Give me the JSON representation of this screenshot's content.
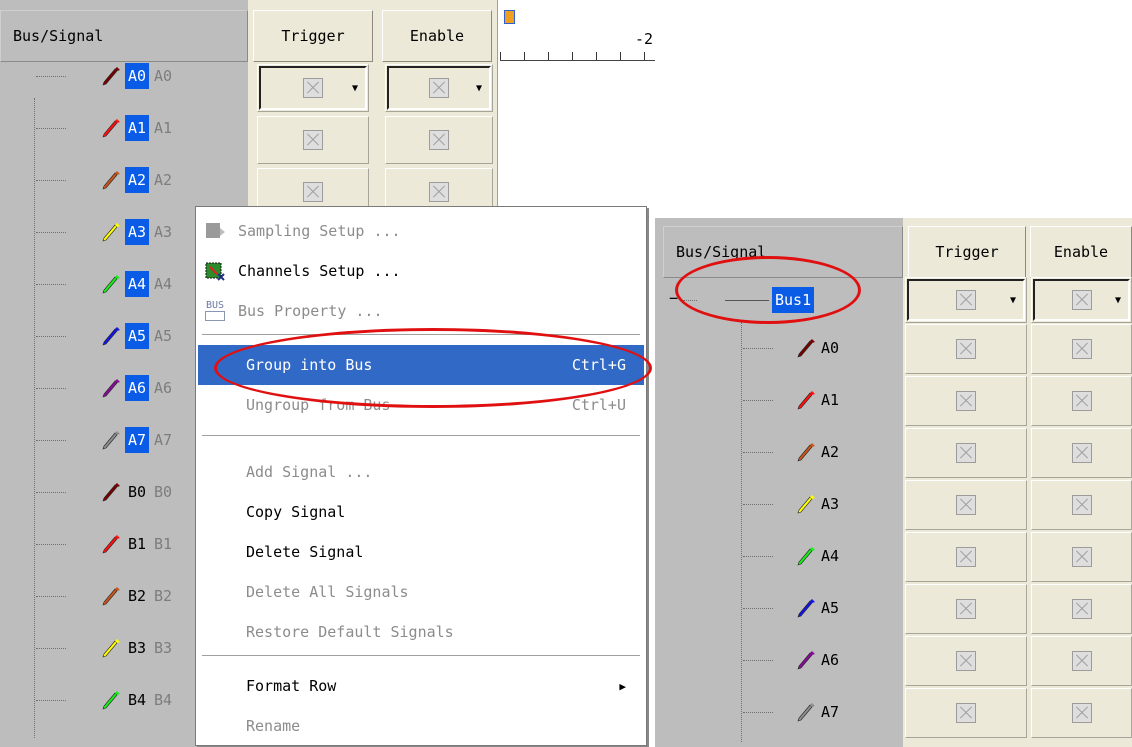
{
  "left_panel": {
    "headers": {
      "signal": "Bus/Signal",
      "trigger": "Trigger",
      "enable": "Enable"
    },
    "ruler_label": "-2",
    "signals": [
      {
        "name": "A0",
        "ghost": "A0",
        "color": "#7a0000",
        "selected": true
      },
      {
        "name": "A1",
        "ghost": "A1",
        "color": "#ff1010",
        "selected": true
      },
      {
        "name": "A2",
        "ghost": "A2",
        "color": "#c8561b",
        "selected": true
      },
      {
        "name": "A3",
        "ghost": "A3",
        "color": "#ffff00",
        "selected": true
      },
      {
        "name": "A4",
        "ghost": "A4",
        "color": "#18ee18",
        "selected": true
      },
      {
        "name": "A5",
        "ghost": "A5",
        "color": "#1414e6",
        "selected": true
      },
      {
        "name": "A6",
        "ghost": "A6",
        "color": "#8a0a9c",
        "selected": true
      },
      {
        "name": "A7",
        "ghost": "A7",
        "color": "#8d8d8d",
        "selected": true
      },
      {
        "name": "B0",
        "ghost": "B0",
        "color": "#7a0000",
        "selected": false
      },
      {
        "name": "B1",
        "ghost": "B1",
        "color": "#ff1010",
        "selected": false
      },
      {
        "name": "B2",
        "ghost": "B2",
        "color": "#c8561b",
        "selected": false
      },
      {
        "name": "B3",
        "ghost": "B3",
        "color": "#ffff00",
        "selected": false
      },
      {
        "name": "B4",
        "ghost": "B4",
        "color": "#18ee18",
        "selected": false
      }
    ]
  },
  "context_menu": {
    "items": [
      {
        "label": "Sampling Setup ...",
        "shortcut": "",
        "disabled": true,
        "icon": "sampling-setup-icon"
      },
      {
        "label": "Channels Setup ...",
        "shortcut": "",
        "disabled": false,
        "icon": "channels-setup-icon"
      },
      {
        "label": "Bus Property ...",
        "shortcut": "",
        "disabled": true,
        "icon": "bus-property-icon",
        "icon_text": "BUS"
      },
      {
        "label": "Group into Bus",
        "shortcut": "Ctrl+G",
        "disabled": false,
        "highlighted": true
      },
      {
        "label": "Ungroup from Bus",
        "shortcut": "Ctrl+U",
        "disabled": true
      },
      {
        "label": "Add Signal ...",
        "shortcut": "",
        "disabled": true
      },
      {
        "label": "Copy Signal",
        "shortcut": "",
        "disabled": false
      },
      {
        "label": "Delete Signal",
        "shortcut": "",
        "disabled": false
      },
      {
        "label": "Delete All Signals",
        "shortcut": "",
        "disabled": true
      },
      {
        "label": "Restore Default Signals",
        "shortcut": "",
        "disabled": true
      },
      {
        "label": "Format Row",
        "shortcut": "",
        "disabled": false,
        "submenu": true
      },
      {
        "label": "Rename",
        "shortcut": "",
        "disabled": true
      }
    ],
    "submenu_arrow": "▶"
  },
  "right_panel": {
    "headers": {
      "signal": "Bus/Signal",
      "trigger": "Trigger",
      "enable": "Enable"
    },
    "bus": {
      "name": "Bus1",
      "expander": "−"
    },
    "signals": [
      {
        "name": "A0",
        "color": "#7a0000"
      },
      {
        "name": "A1",
        "color": "#ff1010"
      },
      {
        "name": "A2",
        "color": "#c8561b"
      },
      {
        "name": "A3",
        "color": "#ffff00"
      },
      {
        "name": "A4",
        "color": "#18ee18"
      },
      {
        "name": "A5",
        "color": "#1414e6"
      },
      {
        "name": "A6",
        "color": "#8a0a9c"
      },
      {
        "name": "A7",
        "color": "#8d8d8d"
      }
    ]
  },
  "colors": {
    "selection": "#0a5ce6",
    "menu_highlight": "#3169c6",
    "annotation_ring": "#e01010"
  }
}
